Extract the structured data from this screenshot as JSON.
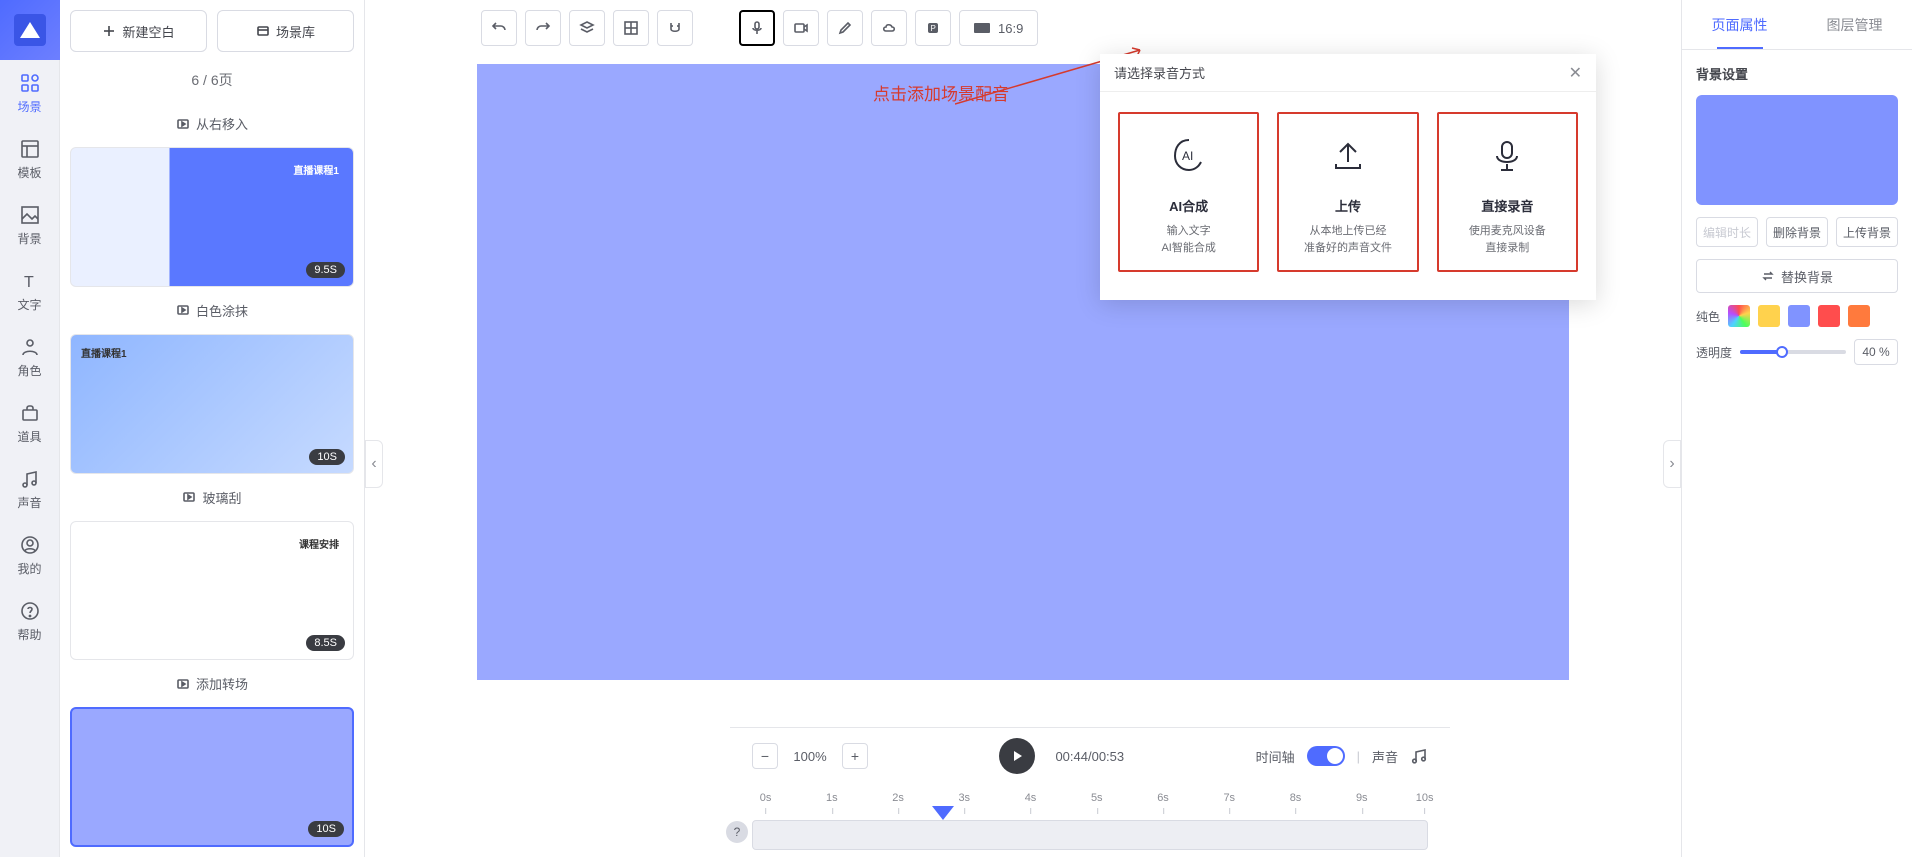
{
  "nav": {
    "items": [
      {
        "label": "场景"
      },
      {
        "label": "模板"
      },
      {
        "label": "背景"
      },
      {
        "label": "文字"
      },
      {
        "label": "角色"
      },
      {
        "label": "道具"
      },
      {
        "label": "声音"
      },
      {
        "label": "我的"
      },
      {
        "label": "帮助"
      }
    ]
  },
  "scene_buttons": {
    "new_blank": "新建空白",
    "scene_lib": "场景库"
  },
  "page_indicator": "6 / 6页",
  "transitions": {
    "t1": "从右移入",
    "t2": "白色涂抹",
    "t3": "玻璃刮",
    "add": "添加转场"
  },
  "scene_durations": {
    "s1": "9.5S",
    "s2": "10S",
    "s3": "8.5S",
    "s4": "10S"
  },
  "scene_titles": {
    "s1": "直播课程1",
    "s2": "直播课程1",
    "s3": "课程安排"
  },
  "toolbar": {
    "ratio": "16:9"
  },
  "annotation": "点击添加场景配音",
  "modal": {
    "title": "请选择录音方式",
    "opt1": {
      "title": "AI合成",
      "line1": "输入文字",
      "line2": "AI智能合成"
    },
    "opt2": {
      "title": "上传",
      "line1": "从本地上传已经",
      "line2": "准备好的声音文件"
    },
    "opt3": {
      "title": "直接录音",
      "line1": "使用麦克风设备",
      "line2": "直接录制"
    }
  },
  "bottom": {
    "zoom": "100%",
    "time": "00:44/00:53",
    "timeline_label": "时间轴",
    "sound_label": "声音",
    "ticks": [
      "0s",
      "1s",
      "2s",
      "3s",
      "4s",
      "5s",
      "6s",
      "7s",
      "8s",
      "9s",
      "10s"
    ]
  },
  "props": {
    "tab1": "页面属性",
    "tab2": "图层管理",
    "bg_section": "背景设置",
    "edit_duration": "编辑时长",
    "del_bg": "删除背景",
    "upload_bg": "上传背景",
    "replace_bg": "替换背景",
    "solid_label": "纯色",
    "colors": [
      "#ffd24d",
      "#8093ff",
      "#ff4d4d",
      "#ff7a3d"
    ],
    "opacity_label": "透明度",
    "opacity_val": "40 %"
  }
}
